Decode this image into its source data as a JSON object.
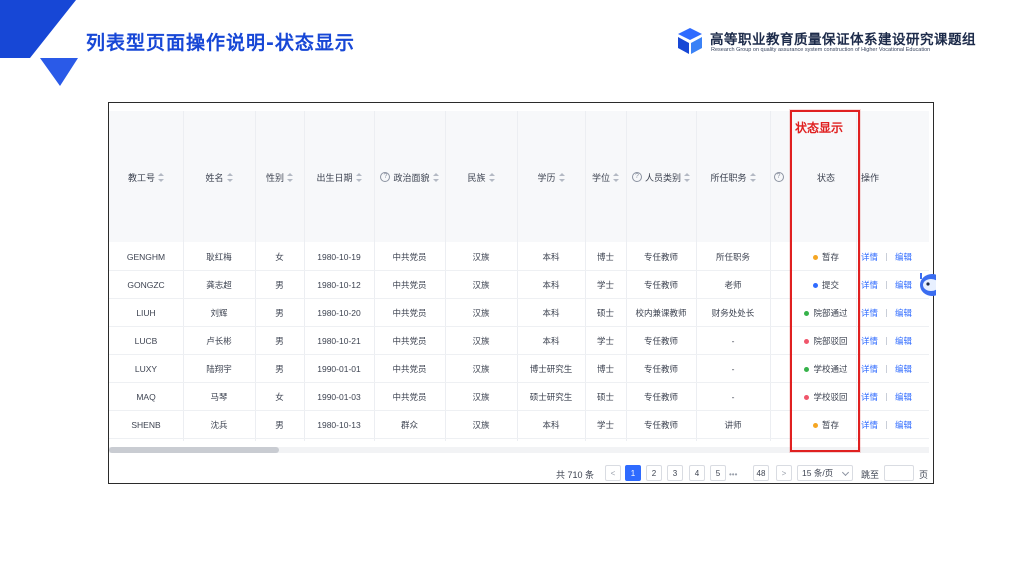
{
  "slide": {
    "title": "列表型页面操作说明-状态显示",
    "org_name": "高等职业教育质量保证体系建设研究课题组",
    "org_subtitle": "Research Group on quality assurance system construction of Higher Vocational Education"
  },
  "annotation": {
    "label": "状态显示",
    "color": "#e02020"
  },
  "table": {
    "headers": {
      "id": "教工号",
      "name": "姓名",
      "gender": "性别",
      "birth": "出生日期",
      "political": "政治面貌",
      "ethnicity": "民族",
      "education": "学历",
      "degree": "学位",
      "staff_type": "人员类别",
      "position": "所任职务",
      "status": "状态",
      "action": "操作"
    },
    "detail_label": "详情",
    "edit_label": "编辑",
    "rows": [
      {
        "id": "GENGHM",
        "name": "耿红梅",
        "gender": "女",
        "birth": "1980-10-19",
        "political": "中共党员",
        "ethnicity": "汉族",
        "education": "本科",
        "degree": "博士",
        "staff_type": "专任教师",
        "position": "所任职务",
        "status": "暂存",
        "status_color": "#f5a623"
      },
      {
        "id": "GONGZC",
        "name": "龚志超",
        "gender": "男",
        "birth": "1980-10-12",
        "political": "中共党员",
        "ethnicity": "汉族",
        "education": "本科",
        "degree": "学士",
        "staff_type": "专任教师",
        "position": "老师",
        "status": "提交",
        "status_color": "#2f6bff"
      },
      {
        "id": "LIUH",
        "name": "刘辉",
        "gender": "男",
        "birth": "1980-10-20",
        "political": "中共党员",
        "ethnicity": "汉族",
        "education": "本科",
        "degree": "硕士",
        "staff_type": "校内兼课教师",
        "position": "财务处处长",
        "status": "院部通过",
        "status_color": "#36b24a"
      },
      {
        "id": "LUCB",
        "name": "卢长彬",
        "gender": "男",
        "birth": "1980-10-21",
        "political": "中共党员",
        "ethnicity": "汉族",
        "education": "本科",
        "degree": "学士",
        "staff_type": "专任教师",
        "position": "-",
        "status": "院部驳回",
        "status_color": "#f0566b"
      },
      {
        "id": "LUXY",
        "name": "陆翔宇",
        "gender": "男",
        "birth": "1990-01-01",
        "political": "中共党员",
        "ethnicity": "汉族",
        "education": "博士研究生",
        "degree": "博士",
        "staff_type": "专任教师",
        "position": "-",
        "status": "学校通过",
        "status_color": "#36b24a"
      },
      {
        "id": "MAQ",
        "name": "马琴",
        "gender": "女",
        "birth": "1990-01-03",
        "political": "中共党员",
        "ethnicity": "汉族",
        "education": "硕士研究生",
        "degree": "硕士",
        "staff_type": "专任教师",
        "position": "-",
        "status": "学校驳回",
        "status_color": "#f0566b"
      },
      {
        "id": "SHENB",
        "name": "沈兵",
        "gender": "男",
        "birth": "1980-10-13",
        "political": "群众",
        "ethnicity": "汉族",
        "education": "本科",
        "degree": "学士",
        "staff_type": "专任教师",
        "position": "讲师",
        "status": "暂存",
        "status_color": "#f5a623"
      }
    ]
  },
  "pagination": {
    "total": "共 710 条",
    "prev": "<",
    "pages": [
      "1",
      "2",
      "3",
      "4",
      "5"
    ],
    "ellipsis": "•••",
    "last": "48",
    "next": ">",
    "page_size": "15 条/页",
    "jump_label": "跳至",
    "page_suffix": "页"
  },
  "colors": {
    "accent": "#2f6bff",
    "title_blue": "#1747d6",
    "highlight_red": "#e02020"
  }
}
